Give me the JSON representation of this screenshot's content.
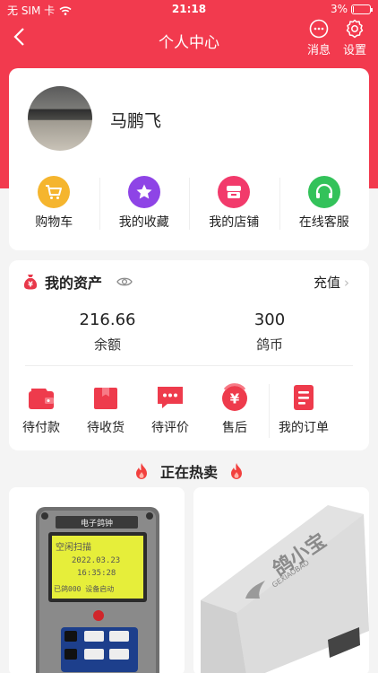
{
  "status_bar": {
    "carrier": "无 SIM 卡",
    "time": "21:18",
    "battery": "3%",
    "battery_level": 0.03
  },
  "nav": {
    "title": "个人中心",
    "messages_label": "消息",
    "settings_label": "设置"
  },
  "profile": {
    "name": "马鹏飞"
  },
  "quick_links": [
    {
      "label": "购物车",
      "icon": "cart-icon",
      "color": "#f5b52e"
    },
    {
      "label": "我的收藏",
      "icon": "star-icon",
      "color": "#8e44e6"
    },
    {
      "label": "我的店铺",
      "icon": "shop-icon",
      "color": "#f23a6b"
    },
    {
      "label": "在线客服",
      "icon": "headset-icon",
      "color": "#33c25a"
    }
  ],
  "assets": {
    "title": "我的资产",
    "recharge_label": "充值",
    "balance_value": "216.66",
    "balance_label": "余额",
    "coins_value": "300",
    "coins_label": "鸽币"
  },
  "orders": [
    {
      "label": "待付款",
      "icon": "wallet-icon"
    },
    {
      "label": "待收货",
      "icon": "package-icon"
    },
    {
      "label": "待评价",
      "icon": "comment-icon"
    },
    {
      "label": "售后",
      "icon": "refund-icon"
    },
    {
      "label": "我的订单",
      "icon": "order-list-icon"
    }
  ],
  "hot_section": {
    "title": "正在热卖"
  },
  "products": [
    {
      "screen_lines": [
        "空闲扫描",
        "2022.03.23",
        "16:35:28",
        "已鸽000 设备启动"
      ],
      "brand_label": "电子鸽钟"
    },
    {
      "brand": "鸽小宝",
      "brand_en": "GEXIAOBAO"
    }
  ],
  "colors": {
    "accent": "#f23a4e",
    "icon_red": "#ee3b4c"
  }
}
